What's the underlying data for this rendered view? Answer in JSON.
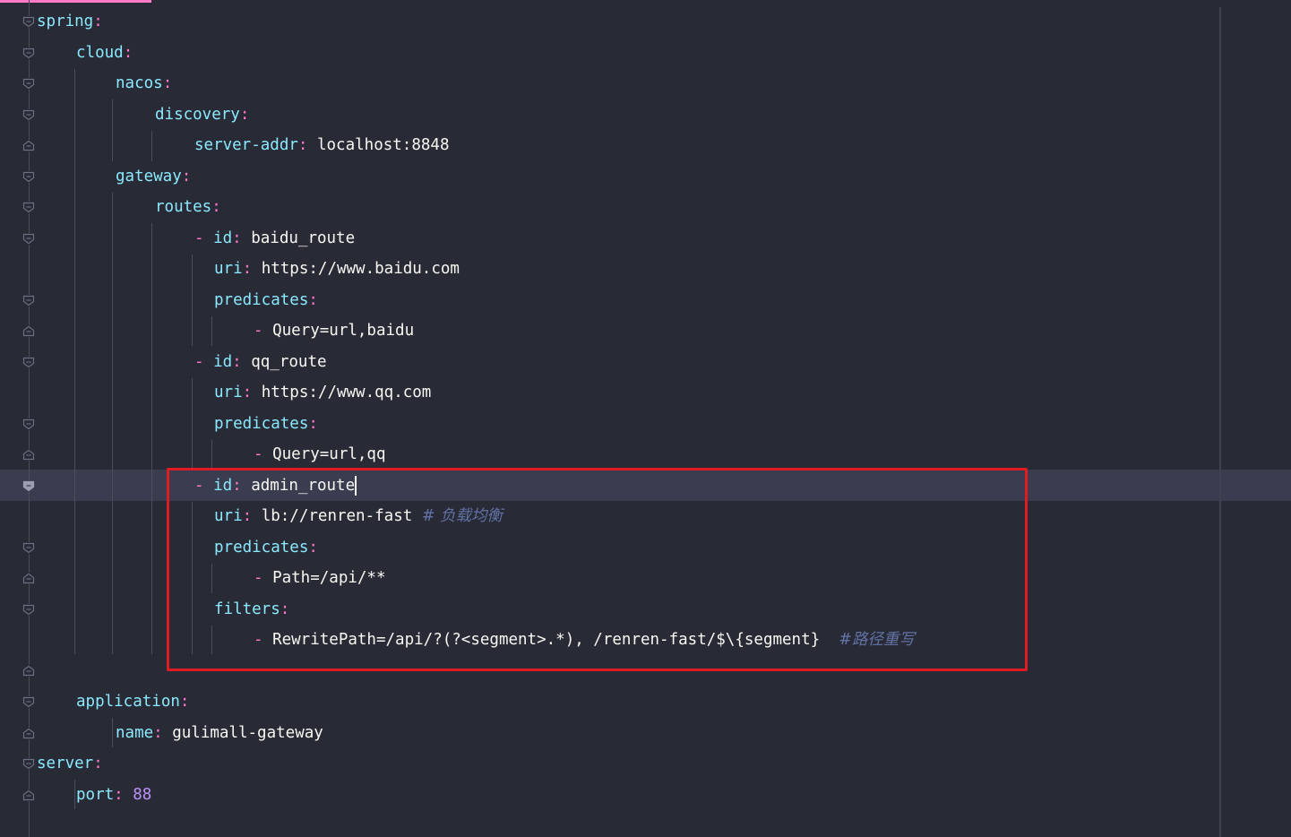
{
  "editor": {
    "language": "yaml",
    "theme": "dark",
    "colors": {
      "background": "#282a36",
      "key": "#8be9fd",
      "punctuation": "#ff79c6",
      "value": "#f8f8f2",
      "number": "#bd93f9",
      "comment": "#6272a4",
      "highlight_box": "#e01b24",
      "current_line": "#3a3d4f"
    },
    "icons": {
      "fold_open": "fold-open-icon",
      "fold_close": "fold-close-icon"
    }
  },
  "code": {
    "spring_key": "spring",
    "cloud_key": "cloud",
    "nacos_key": "nacos",
    "discovery_key": "discovery",
    "server_addr_key": "server-addr",
    "server_addr_value": "localhost:8848",
    "gateway_key": "gateway",
    "routes_key": "routes",
    "routes": [
      {
        "id_key": "id",
        "id_value": "baidu_route",
        "uri_key": "uri",
        "uri_value": "https://www.baidu.com",
        "predicates_key": "predicates",
        "predicate": "Query=url,baidu"
      },
      {
        "id_key": "id",
        "id_value": "qq_route",
        "uri_key": "uri",
        "uri_value": "https://www.qq.com",
        "predicates_key": "predicates",
        "predicate": "Query=url,qq"
      },
      {
        "id_key": "id",
        "id_value": "admin_route",
        "uri_key": "uri",
        "uri_value": "lb://renren-fast",
        "uri_comment": "# 负载均衡",
        "predicates_key": "predicates",
        "predicate": "Path=/api/**",
        "filters_key": "filters",
        "filter": "RewritePath=/api/?(?<segment>.*), /renren-fast/$\\{segment}",
        "filter_comment": "#路径重写"
      }
    ],
    "application_key": "application",
    "name_key": "name",
    "name_value": "gulimall-gateway",
    "server_key": "server",
    "port_key": "port",
    "port_value": "88"
  }
}
